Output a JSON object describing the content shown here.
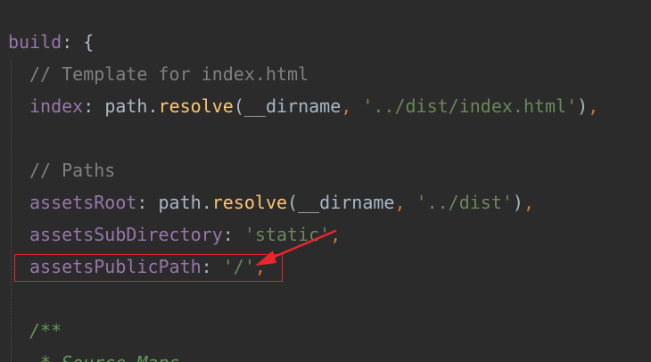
{
  "code": {
    "build_key": "build",
    "build_colon_brace": ": {",
    "comment_template": "// Template for index.html",
    "index_key": "index",
    "index_colon": ": ",
    "path_obj": "path",
    "dot": ".",
    "resolve_fn": "resolve",
    "open_paren": "(",
    "dirname": "__dirname",
    "arg_comma": ", ",
    "index_str": "'../dist/index.html'",
    "close_paren": ")",
    "trail_comma": ",",
    "comment_paths": "// Paths",
    "assets_root_key": "assetsRoot",
    "assets_root_colon": ": ",
    "dist_str": "'../dist'",
    "assets_sub_key": "assetsSubDirectory",
    "assets_sub_colon": ": ",
    "static_str": "'static'",
    "assets_pub_key": "assetsPublicPath",
    "assets_pub_colon": ": ",
    "slash_str": "'/'",
    "doc_open": "/**",
    "doc_source": " * Source Maps"
  },
  "annotation": {
    "box_color": "#e8272b",
    "arrow_color": "#e8272b"
  },
  "theme": {
    "background": "#2b2b2b",
    "property": "#9876aa",
    "function": "#ffc66d",
    "string": "#6a8759",
    "keyword_punct": "#cc7832",
    "comment": "#808080"
  }
}
